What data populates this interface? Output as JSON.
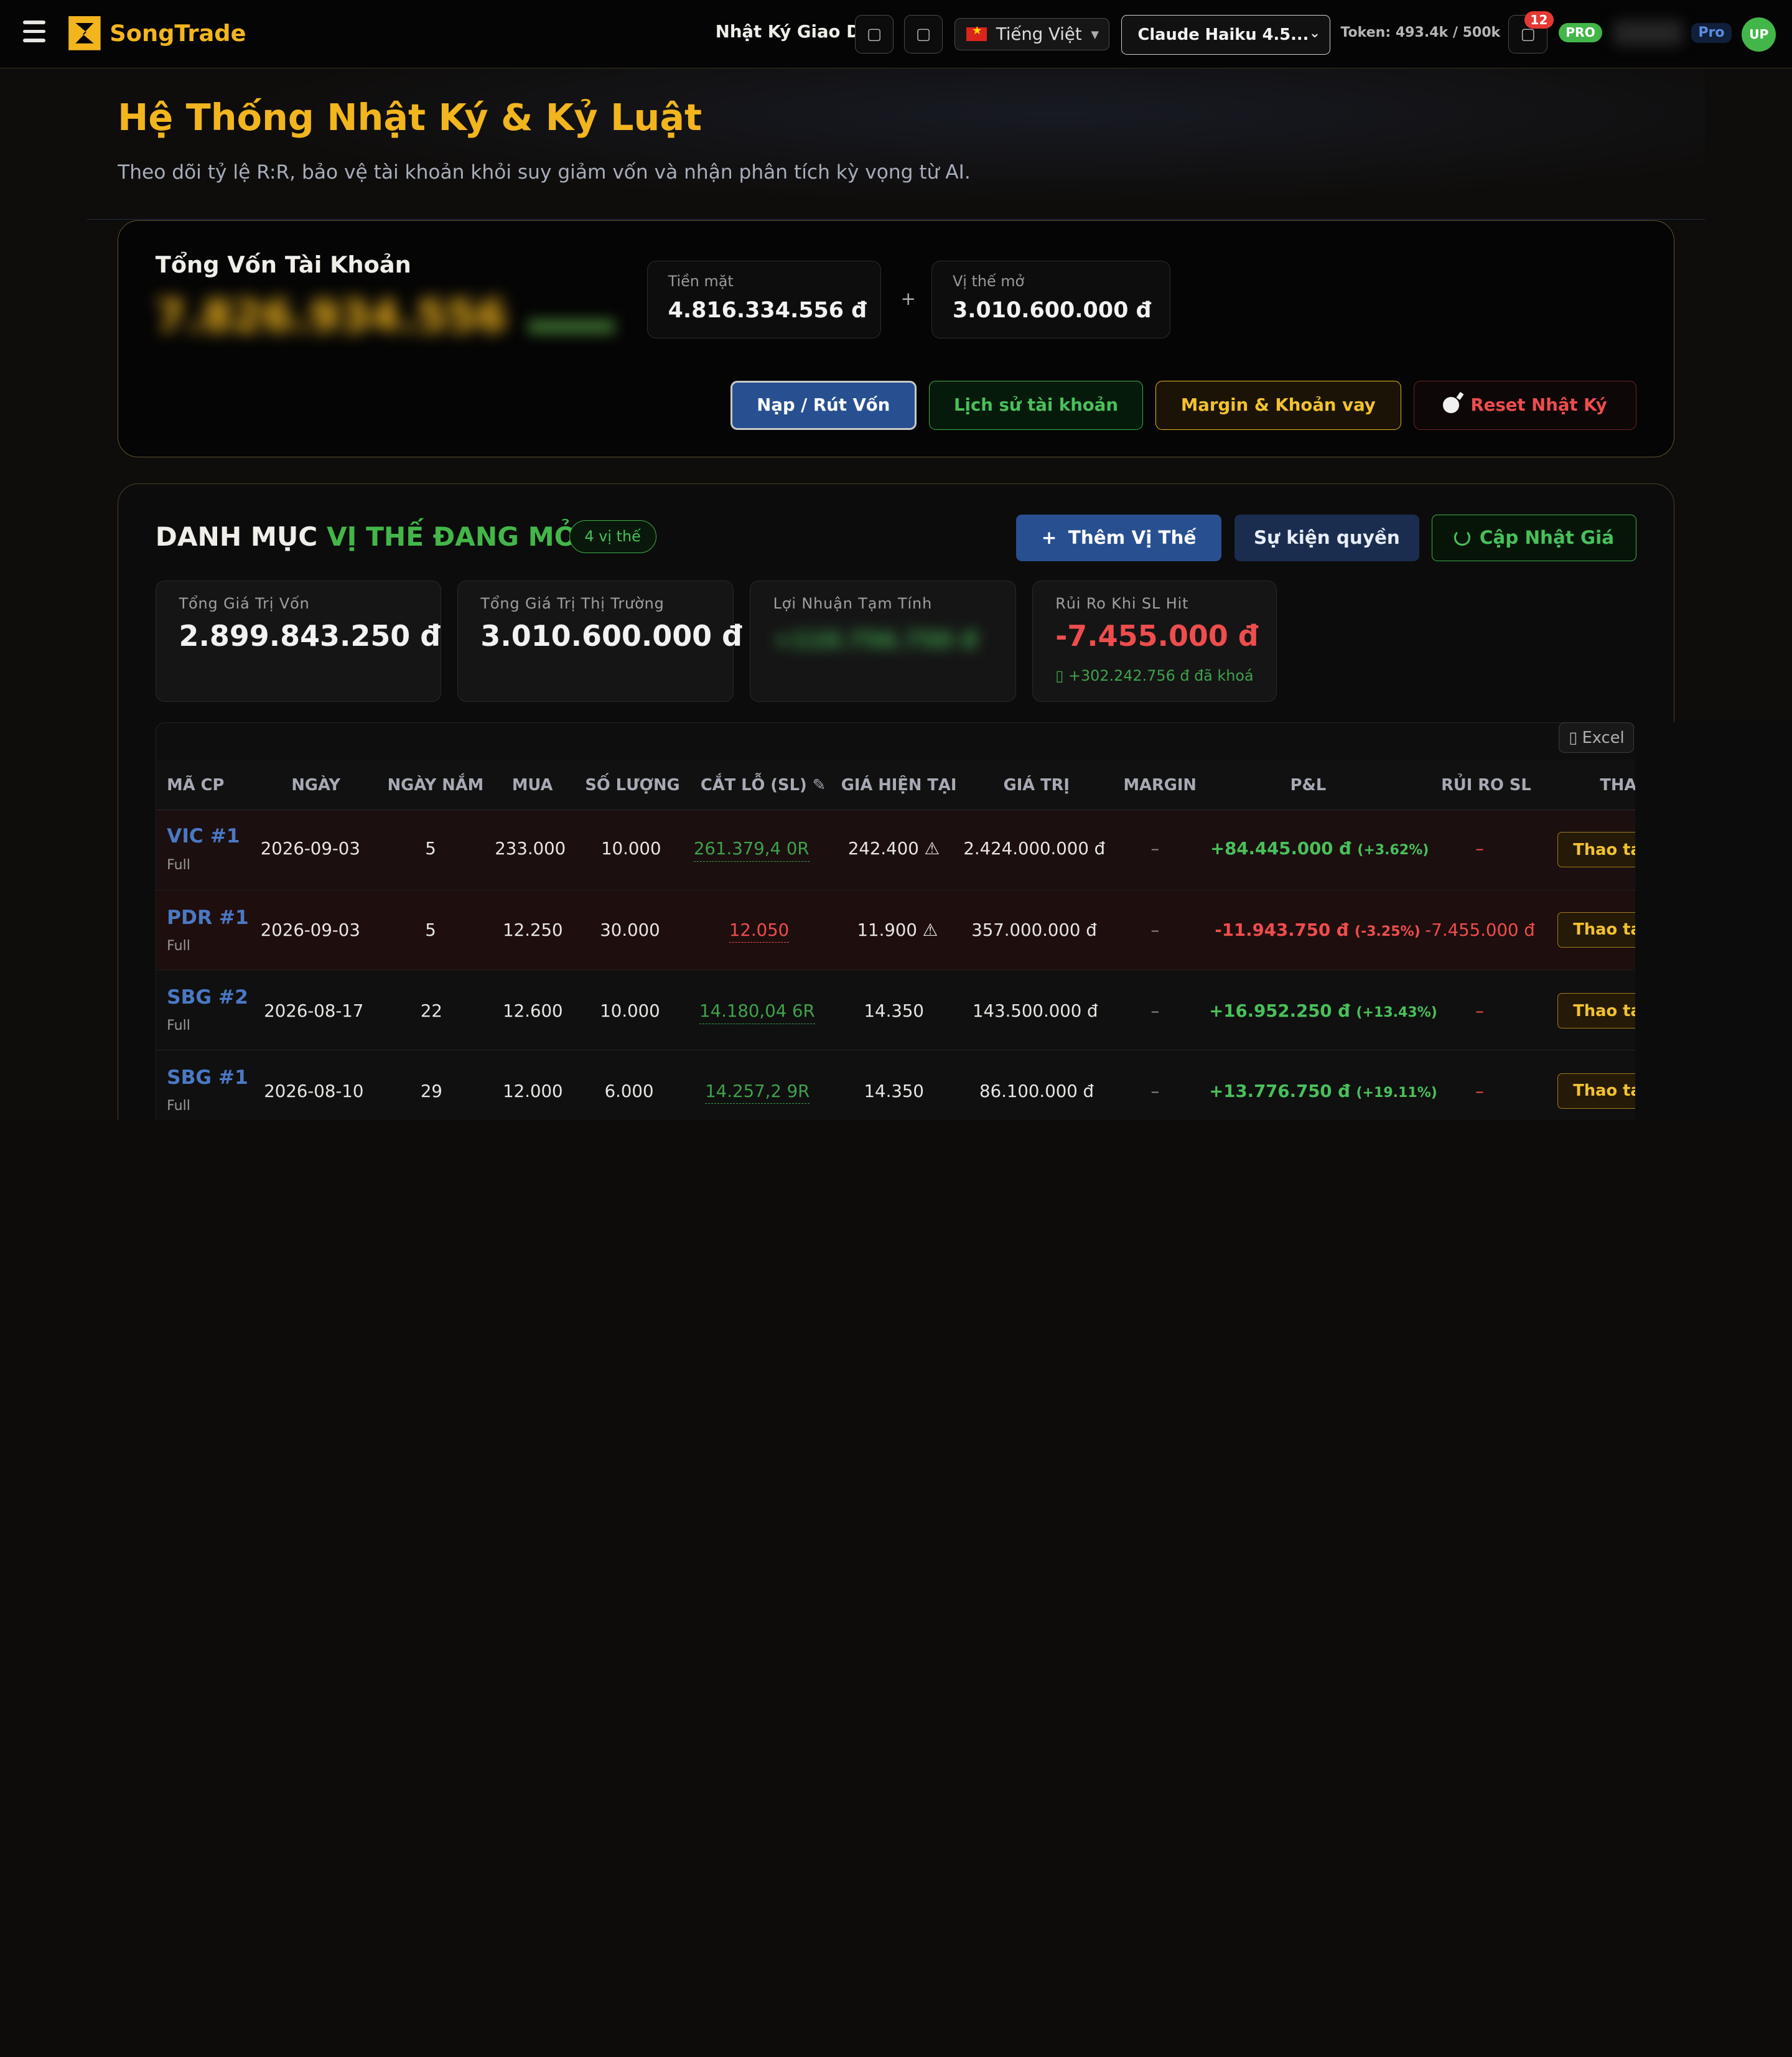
{
  "topbar": {
    "logo_text": "SongTrade",
    "nav_title": "Nhật Ký Giao Dị...",
    "language": "Tiếng Việt",
    "model": "Claude Haiku 4.5...",
    "token": "Token: 493.4k / 500k",
    "notification_count": "12",
    "pro_badge": "PRO",
    "pro_tag": "Pro",
    "avatar_initials": "UP"
  },
  "header": {
    "title": "Hệ Thống Nhật Ký & Kỷ Luật",
    "subtitle": "Theo dõi tỷ lệ R:R, bảo vệ tài khoản khỏi suy giảm vốn và nhận phân tích kỳ vọng từ AI."
  },
  "account": {
    "title": "Tổng Vốn Tài Khoản",
    "total_hidden": "7.826.934.556",
    "cash_label": "Tiền mặt",
    "cash_value": "4.816.334.556 đ",
    "plus": "+",
    "open_label": "Vị thế mở",
    "open_value": "3.010.600.000 đ",
    "buttons": {
      "deposit": "Nạp / Rút Vốn",
      "history": "Lịch sử tài khoản",
      "margin": "Margin & Khoản vay",
      "reset": "Reset Nhật Ký"
    }
  },
  "positions": {
    "title_white": "DANH MỤC",
    "title_green": "VỊ THẾ ĐANG MỞ",
    "count": "4 vị thế",
    "buttons": {
      "add": "Thêm Vị Thế",
      "events": "Sự kiện quyền",
      "update": "Cập Nhật Giá"
    },
    "stats": {
      "cost_label": "Tổng Giá Trị Vốn",
      "cost_value": "2.899.843.250 đ",
      "market_label": "Tổng Giá Trị Thị Trường",
      "market_value": "3.010.600.000 đ",
      "profit_label": "Lợi Nhuận Tạm Tính",
      "profit_hidden": "+110.756.750 đ",
      "risk_label": "Rủi Ro Khi SL Hit",
      "risk_value": "-7.455.000 đ",
      "risk_note": "+302.242.756 đ đã khoá"
    },
    "excel": "Excel",
    "columns": [
      "MÃ CP",
      "NGÀY",
      "NGÀY NẮM",
      "MUA",
      "SỐ LƯỢNG",
      "CẮT LỖ (SL) ✎",
      "GIÁ HIỆN TẠI",
      "GIÁ TRỊ",
      "MARGIN",
      "P&L",
      "RỦI RO SL",
      "THAO TÁC"
    ],
    "rows": [
      {
        "code": "VIC #1",
        "type": "Full",
        "date": "2026-09-03",
        "days": "5",
        "buy": "233.000",
        "qty": "10.000",
        "sl": "261.379,4 0R",
        "price": "242.400 ⚠",
        "value": "2.424.000.000 đ",
        "margin": "–",
        "pnl": "+84.445.000 đ",
        "pnl_pct": "(+3.62%)",
        "risk": "–",
        "action": "Thao tác"
      },
      {
        "code": "PDR #1",
        "type": "Full",
        "date": "2026-09-03",
        "days": "5",
        "buy": "12.250",
        "qty": "30.000",
        "sl": "12.050",
        "price": "11.900 ⚠",
        "value": "357.000.000 đ",
        "margin": "–",
        "pnl": "-11.943.750 đ",
        "pnl_pct": "(-3.25%)",
        "risk": "-7.455.000 đ",
        "action": "Thao tác"
      },
      {
        "code": "SBG #2",
        "type": "Full",
        "date": "2026-08-17",
        "days": "22",
        "buy": "12.600",
        "qty": "10.000",
        "sl": "14.180,04 6R",
        "price": "14.350",
        "value": "143.500.000 đ",
        "margin": "–",
        "pnl": "+16.952.250 đ",
        "pnl_pct": "(+13.43%)",
        "risk": "–",
        "action": "Thao tác"
      },
      {
        "code": "SBG #1",
        "type": "Full",
        "date": "2026-08-10",
        "days": "29",
        "buy": "12.000",
        "qty": "6.000",
        "sl": "14.257,2 9R",
        "price": "14.350",
        "value": "86.100.000 đ",
        "margin": "–",
        "pnl": "+13.776.750 đ",
        "pnl_pct": "(+19.11%)",
        "risk": "–",
        "action": "Thao tác"
      }
    ]
  },
  "colors": {
    "accent": "#f2b51e",
    "green": "#43b649",
    "red": "#ef4d4d",
    "blue": "#285091"
  }
}
